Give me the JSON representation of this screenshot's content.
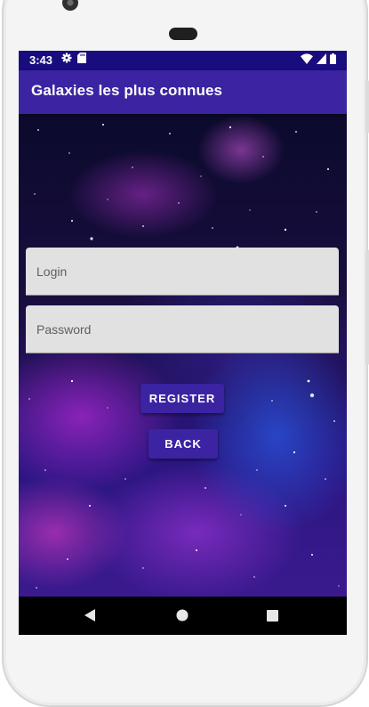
{
  "status_bar": {
    "time": "3:43",
    "left_icons": [
      "gear-icon",
      "sd-card-icon"
    ],
    "right_icons": [
      "wifi-icon",
      "signal-icon",
      "battery-icon"
    ]
  },
  "app_bar": {
    "title": "Galaxies les plus connues"
  },
  "form": {
    "login_placeholder": "Login",
    "password_placeholder": "Password"
  },
  "buttons": {
    "register_label": "REGISTER",
    "back_label": "BACK"
  },
  "nav_bar": {
    "icons": [
      "back-triangle-icon",
      "home-circle-icon",
      "recents-square-icon"
    ]
  },
  "colors": {
    "status_bar": "#180c7e",
    "primary": "#3b23a2",
    "field_background": "#e1e1e1",
    "nav_bar": "#000000"
  }
}
